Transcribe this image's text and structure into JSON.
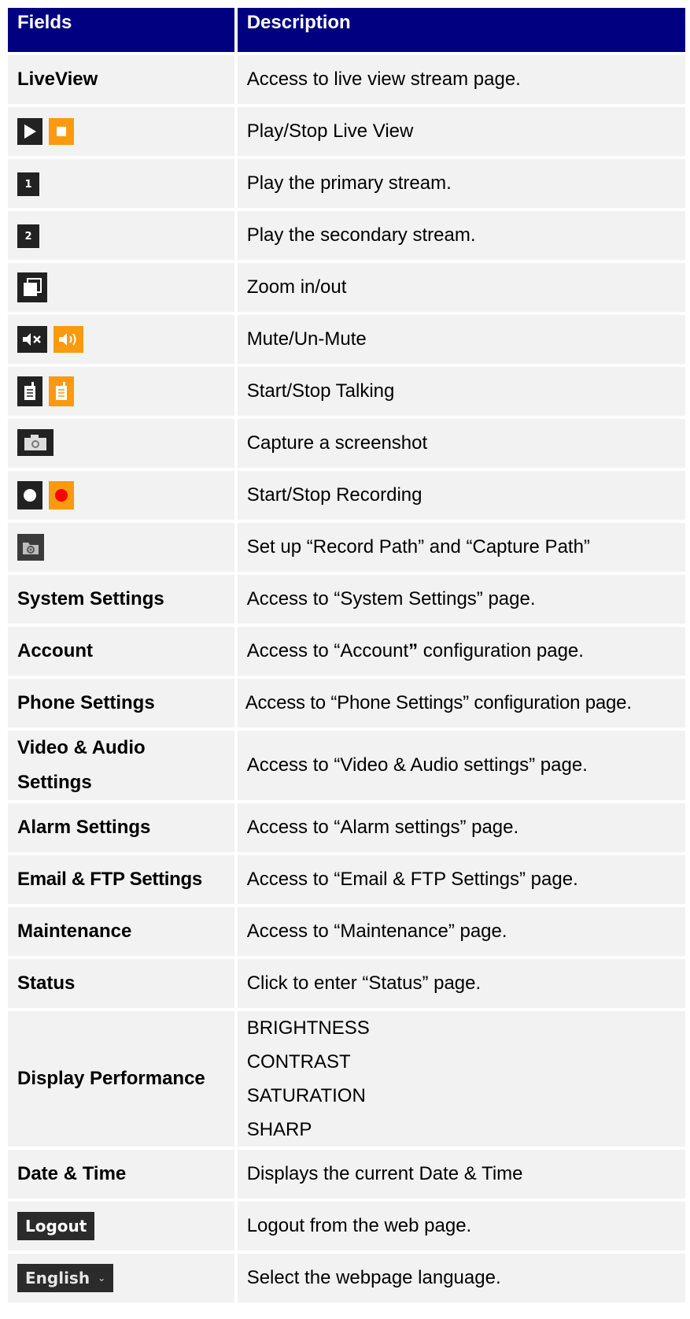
{
  "header": {
    "fields": "Fields",
    "description": "Description"
  },
  "rows": [
    {
      "field": "LiveView",
      "desc": "Access to live view stream page."
    },
    {
      "icons": [
        "play-icon",
        "stop-icon"
      ],
      "desc": "Play/Stop Live View"
    },
    {
      "icon_text": "1",
      "desc": "Play the primary stream."
    },
    {
      "icon_text": "2",
      "desc": "Play the secondary stream."
    },
    {
      "icons": [
        "zoom-icon"
      ],
      "desc": "Zoom in/out"
    },
    {
      "icons": [
        "mute-icon",
        "unmute-icon"
      ],
      "desc": "Mute/Un-Mute"
    },
    {
      "icons": [
        "talk-start-icon",
        "talk-stop-icon"
      ],
      "desc": "Start/Stop Talking"
    },
    {
      "icons": [
        "camera-icon"
      ],
      "desc": "Capture a screenshot"
    },
    {
      "icons": [
        "record-start-icon",
        "record-stop-icon"
      ],
      "desc": "Start/Stop Recording"
    },
    {
      "icons": [
        "folder-settings-icon"
      ],
      "desc": "Set up “Record Path” and “Capture Path”"
    },
    {
      "field": "System Settings",
      "desc": "Access to “System Settings” page."
    },
    {
      "field": "Account",
      "desc_pre": "Access to “Account",
      "desc_bold": "”",
      "desc_post": " configuration page."
    },
    {
      "field": "Phone Settings",
      "desc": "Access to “Phone Settings” configuration page."
    },
    {
      "field_line1": "Video & Audio",
      "field_line2": "Settings",
      "desc": "Access to “Video & Audio settings” page."
    },
    {
      "field": "Alarm Settings",
      "desc": "Access to “Alarm settings” page."
    },
    {
      "field": "Email & FTP Settings",
      "desc": "Access to “Email & FTP Settings” page."
    },
    {
      "field": "Maintenance",
      "desc": "Access to “Maintenance” page."
    },
    {
      "field": "Status",
      "desc": "Click to enter “Status” page."
    },
    {
      "field": "Display Performance",
      "desc_list": [
        "BRIGHTNESS",
        "CONTRAST",
        "SATURATION",
        "SHARP"
      ]
    },
    {
      "field": "Date & Time",
      "desc": "Displays the current Date & Time"
    },
    {
      "button_label": "Logout",
      "desc": "Logout from the web page."
    },
    {
      "select_label": "English",
      "desc": "Select the webpage language."
    }
  ],
  "colors": {
    "header_bg": "#000080",
    "row_bg": "#f2f2f2",
    "icon_dark": "#222222",
    "icon_orange": "#f99a0f",
    "record_red": "#ff0000"
  }
}
